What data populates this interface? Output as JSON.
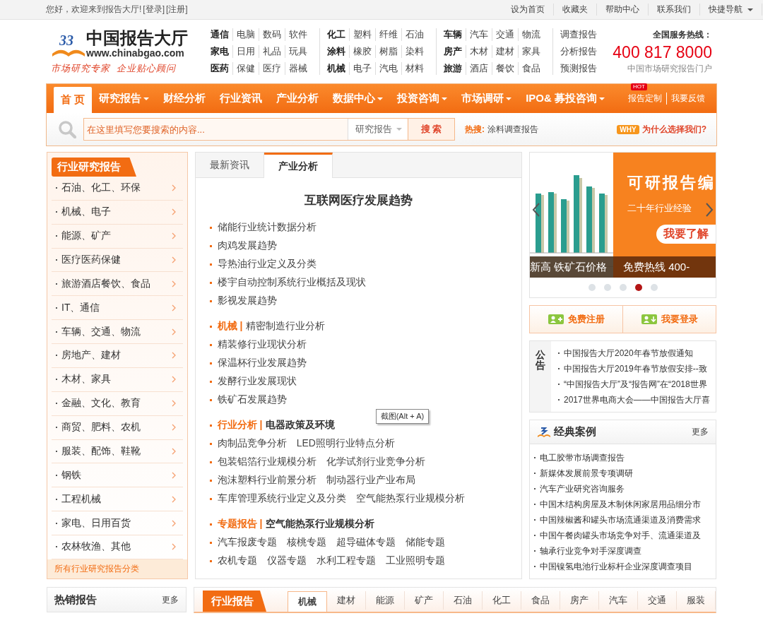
{
  "top_bar": {
    "greeting": "您好，欢迎来到报告大厅!",
    "login": "[登录]",
    "register": "[注册]",
    "links": [
      {
        "label": "设为首页",
        "dropdown": false
      },
      {
        "label": "收藏夹",
        "dropdown": false
      },
      {
        "label": "帮助中心",
        "dropdown": false
      },
      {
        "label": "联系我们",
        "dropdown": false
      },
      {
        "label": "快捷导航",
        "dropdown": true
      }
    ]
  },
  "header": {
    "logo": {
      "mark": "33",
      "name": "中国报告大厅",
      "url": "www.chinabgao.com",
      "slogan": "市场研究专家  企业贴心顾问"
    },
    "category_columns": [
      [
        {
          "head": "通信",
          "items": [
            "电脑",
            "数码",
            "软件"
          ]
        },
        {
          "head": "家电",
          "items": [
            "日用",
            "礼品",
            "玩具"
          ]
        },
        {
          "head": "医药",
          "items": [
            "保健",
            "医疗",
            "器械"
          ]
        }
      ],
      [
        {
          "head": "化工",
          "items": [
            "塑料",
            "纤维",
            "石油"
          ]
        },
        {
          "head": "涂料",
          "items": [
            "橡胶",
            "树脂",
            "染料"
          ]
        },
        {
          "head": "机械",
          "items": [
            "电子",
            "汽电",
            "材料"
          ]
        }
      ],
      [
        {
          "head": "车辆",
          "items": [
            "汽车",
            "交通",
            "物流"
          ]
        },
        {
          "head": "房产",
          "items": [
            "木材",
            "建材",
            "家具"
          ]
        },
        {
          "head": "旅游",
          "items": [
            "酒店",
            "餐饮",
            "食品"
          ]
        }
      ]
    ],
    "report_types": [
      "调查报告",
      "分析报告",
      "预测报告"
    ],
    "hotline": {
      "label": "全国服务热线：",
      "number": "400 817 8000",
      "caption": "中国市场研究报告门户"
    }
  },
  "nav": {
    "items": [
      {
        "label": "首 页",
        "selected": true,
        "dropdown": false
      },
      {
        "label": "研究报告",
        "selected": false,
        "dropdown": true
      },
      {
        "label": "财经分析",
        "selected": false,
        "dropdown": false
      },
      {
        "label": "行业资讯",
        "selected": false,
        "dropdown": false
      },
      {
        "label": "产业分析",
        "selected": false,
        "dropdown": false
      },
      {
        "label": "数据中心",
        "selected": false,
        "dropdown": true
      },
      {
        "label": "投资咨询",
        "selected": false,
        "dropdown": true
      },
      {
        "label": "市场调研",
        "selected": false,
        "dropdown": true
      },
      {
        "label": "IPO& 募投咨询",
        "selected": false,
        "dropdown": true
      }
    ],
    "hot_badge": "HOT",
    "right_links": [
      "报告定制",
      "我要反馈"
    ]
  },
  "search": {
    "placeholder": "在这里填写您要搜索的内容...",
    "category": "研究报告",
    "button": "搜 索",
    "hot_label": "热搜:",
    "hot_term": "涂料调查报告",
    "why_badge": "WHY",
    "why_text": "为什么选择我们?"
  },
  "sidebar": {
    "title": "行业研究报告",
    "items": [
      "石油、化工、环保",
      "机械、电子",
      "能源、矿产",
      "医疗医药保健",
      "旅游酒店餐饮、食品",
      "IT、通信",
      "车辆、交通、物流",
      "房地产、建材",
      "木材、家具",
      "金融、文化、教育",
      "商贸、肥料、农机",
      "服装、配饰、鞋靴",
      "钢铁",
      "工程机械",
      "家电、日用百货",
      "农林牧渔、其他"
    ],
    "footer": "所有行业研究报告分类"
  },
  "center": {
    "tabs": [
      {
        "label": "最新资讯",
        "selected": false
      },
      {
        "label": "产业分析",
        "selected": true
      }
    ],
    "headline": "互联网医疗发展趋势",
    "sections": [
      {
        "rows": [
          [
            "储能行业统计数据分析"
          ],
          [
            "肉鸡发展趋势"
          ],
          [
            "导热油行业定义及分类"
          ],
          [
            "楼宇自动控制系统行业概括及现状"
          ],
          [
            "影视发展趋势"
          ]
        ]
      },
      {
        "heading": {
          "tag": "机械 |",
          "title": "精密制造行业分析",
          "strong": false
        },
        "rows": [
          [
            "精装修行业现状分析"
          ],
          [
            "保温杯行业发展趋势"
          ],
          [
            "发酵行业发展现状"
          ],
          [
            "铁矿石发展趋势"
          ]
        ]
      },
      {
        "heading": {
          "tag": "行业分析 |",
          "title": "电器政策及环境",
          "strong": true
        },
        "rows": [
          [
            "肉制品竞争分析",
            "LED照明行业特点分析"
          ],
          [
            "包装铝箔行业规模分析",
            "化学试剂行业竞争分析"
          ],
          [
            "泡沫塑料行业前景分析",
            "制动器行业产业布局"
          ],
          [
            "车库管理系统行业定义及分类",
            "空气能热泵行业规模分析"
          ]
        ]
      },
      {
        "heading": {
          "tag": "专题报告 |",
          "title": "空气能热泵行业规模分析",
          "strong": true
        },
        "rows": [
          [
            "汽车报废专题",
            "核桃专题",
            "超导磁体专题",
            "储能专题"
          ],
          [
            "农机专题",
            "仪器专题",
            "水利工程专题",
            "工业照明专题"
          ]
        ]
      }
    ],
    "tooltip": "截图(Alt + A)"
  },
  "carousel": {
    "left_caption": "新高 铁矿石价格",
    "title": "可研报告编",
    "subtitle": "二十年行业经验",
    "cta": "我要了解",
    "hotline": "免费热线 400-",
    "dots": [
      {
        "selected": false
      },
      {
        "selected": false
      },
      {
        "selected": false
      },
      {
        "selected": true
      },
      {
        "selected": false
      }
    ]
  },
  "account_buttons": [
    "免费注册",
    "我要登录"
  ],
  "notice": {
    "label": "公告",
    "items": [
      "中国报告大厅2020年春节放假通知",
      "中国报告大厅2019年春节放假安排--致",
      "“中国报告大厅”及“报告网”在“2018世界",
      "2017世界电商大会——中国报告大厅喜"
    ]
  },
  "cases": {
    "title": "经典案例",
    "more": "更多",
    "items": [
      "电工胶带市场调查报告",
      "新媒体发展前景专项调研",
      "汽车产业研究咨询服务",
      "中国木结构房屋及木制休闲家居用品细分市",
      "中国辣椒酱和罐头市场流通渠道及消费需求",
      "中国午餐肉罐头市场竞争对手、流通渠道及",
      "轴承行业竞争对手深度调查",
      "中国镍氢电池行业标杆企业深度调查项目"
    ]
  },
  "hot_reports": {
    "title": "热销报告",
    "more": "更多"
  },
  "industry_reports": {
    "title": "行业报告",
    "tabs": [
      {
        "label": "机械",
        "selected": true
      },
      {
        "label": "建材",
        "selected": false
      },
      {
        "label": "能源",
        "selected": false
      },
      {
        "label": "矿产",
        "selected": false
      },
      {
        "label": "石油",
        "selected": false
      },
      {
        "label": "化工",
        "selected": false
      },
      {
        "label": "食品",
        "selected": false
      },
      {
        "label": "房产",
        "selected": false
      },
      {
        "label": "汽车",
        "selected": false
      },
      {
        "label": "交通",
        "selected": false
      },
      {
        "label": "服装",
        "selected": false
      }
    ]
  }
}
